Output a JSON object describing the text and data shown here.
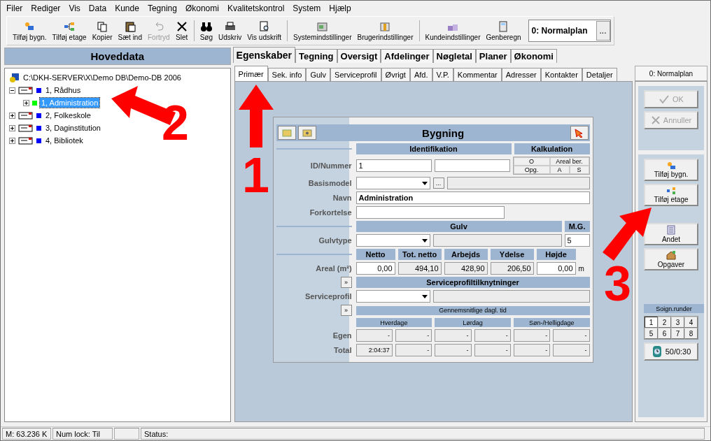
{
  "menu": [
    "Filer",
    "Rediger",
    "Vis",
    "Data",
    "Kunde",
    "Tegning",
    "Økonomi",
    "Kvalitetskontrol",
    "System",
    "Hjælp"
  ],
  "toolbar": [
    {
      "label": "Tilføj bygn.",
      "disabled": false
    },
    {
      "label": "Tilføj etage",
      "disabled": false
    },
    {
      "label": "Kopier",
      "disabled": false
    },
    {
      "label": "Sæt ind",
      "disabled": false
    },
    {
      "label": "Fortryd",
      "disabled": true
    },
    {
      "label": "Slet",
      "disabled": false
    },
    {
      "label": "Søg",
      "disabled": false
    },
    {
      "label": "Udskriv",
      "disabled": false
    },
    {
      "label": "Vis udskrift",
      "disabled": false
    },
    {
      "label": "Systemindstillinger",
      "disabled": false
    },
    {
      "label": "Brugerindstillinger",
      "disabled": false
    },
    {
      "label": "Kundeindstillinger",
      "disabled": false
    },
    {
      "label": "Genberegn",
      "disabled": false
    }
  ],
  "plan_selector": {
    "value": "0: Normalplan",
    "button": "..."
  },
  "left_panel": {
    "title": "Hoveddata",
    "root": "C:\\DKH-SERVER\\X\\Demo DB\\Demo-DB 2006",
    "tree": [
      {
        "label": "1, Rådhus",
        "color": "#0000ff",
        "expanded": true,
        "selected": false,
        "children": [
          {
            "label": "1, Administration",
            "color": "#00ff00",
            "expanded": false,
            "selected": true
          }
        ]
      },
      {
        "label": "2, Folkeskole",
        "color": "#0000ff",
        "expanded": false,
        "selected": false
      },
      {
        "label": "3, Daginstitution",
        "color": "#0000ff",
        "expanded": false,
        "selected": false
      },
      {
        "label": "4, Bibliotek",
        "color": "#0000ff",
        "expanded": false,
        "selected": false
      }
    ]
  },
  "main_tabs": [
    {
      "label": "Egenskaber",
      "selected": true
    },
    {
      "label": "Tegning",
      "selected": false
    },
    {
      "label": "Oversigt",
      "selected": false
    },
    {
      "label": "Afdelinger",
      "selected": false
    },
    {
      "label": "Nøgletal",
      "selected": false
    },
    {
      "label": "Planer",
      "selected": false
    },
    {
      "label": "Økonomi",
      "selected": false
    }
  ],
  "sub_tabs": [
    {
      "label": "Primær",
      "selected": true
    },
    {
      "label": "Sek. info",
      "selected": false
    },
    {
      "label": "Gulv",
      "selected": false
    },
    {
      "label": "Serviceprofil",
      "selected": false
    },
    {
      "label": "Øvrigt",
      "selected": false
    },
    {
      "label": "Afd.",
      "selected": false
    },
    {
      "label": "V.P.",
      "selected": false
    },
    {
      "label": "Kommentar",
      "selected": false
    },
    {
      "label": "Adresser",
      "selected": false
    },
    {
      "label": "Kontakter",
      "selected": false
    },
    {
      "label": "Detaljer",
      "selected": false
    }
  ],
  "form": {
    "title": "Bygning",
    "identification_heading": "Identifikation",
    "calculation_heading": "Kalkulation",
    "calculation_cells": [
      "O",
      "Areal ber.",
      "Opg.",
      "A",
      "S"
    ],
    "id_label": "ID/Nummer",
    "id_value": "1",
    "basismodel_label": "Basismodel",
    "lookup_button": "...",
    "name_label": "Navn",
    "name_value": "Administration",
    "abbreviation_label": "Forkortelse",
    "floor_heading": "Gulv",
    "mg_heading": "M.G.",
    "floor_type_label": "Gulvtype",
    "mg_value": "5",
    "area_columns": [
      "Netto",
      "Tot. netto",
      "Arbejds",
      "Ydelse",
      "Højde"
    ],
    "area_label": "Areal (m²)",
    "area_values": [
      "0,00",
      "494,10",
      "428,90",
      "206,50",
      "0,00"
    ],
    "height_unit": "m",
    "expand_button": "»",
    "service_heading": "Serviceprofiltilknytninger",
    "service_label": "Serviceprofil",
    "time_expand_button": "»",
    "time_heading": "Gennemsnitlige dagl. tid",
    "time_groups": [
      "Hverdage",
      "Lørdag",
      "Søn-/Helligdage"
    ],
    "time_rows": [
      {
        "label": "Egen",
        "cells": [
          "-",
          "-",
          "-",
          "-",
          "-",
          "-"
        ]
      },
      {
        "label": "Total",
        "cells": [
          "2:04:37",
          "-",
          "-",
          "-",
          "-",
          "-"
        ]
      }
    ]
  },
  "right_panel": {
    "tab": "0: Normalplan",
    "ok": {
      "label": "OK",
      "disabled": true
    },
    "cancel": {
      "label": "Annuller",
      "disabled": true
    },
    "buttons": [
      "Tilføj bygn.",
      "Tilføj etage",
      "Andet",
      "Opgaver"
    ],
    "rounds_heading": "Soign.runder",
    "rounds": [
      {
        "label": "1",
        "selected": true
      },
      {
        "label": "2",
        "selected": false
      },
      {
        "label": "3",
        "selected": false
      },
      {
        "label": "4",
        "selected": false
      },
      {
        "label": "5",
        "selected": false
      },
      {
        "label": "6",
        "selected": false
      },
      {
        "label": "7",
        "selected": false
      },
      {
        "label": "8",
        "selected": false
      }
    ],
    "timer": "50/0:30"
  },
  "status_bar": {
    "memory": "M: 63.236 K",
    "num_lock": "Num lock: Til",
    "status": "Status:"
  },
  "annotations": [
    "1",
    "2",
    "3"
  ]
}
